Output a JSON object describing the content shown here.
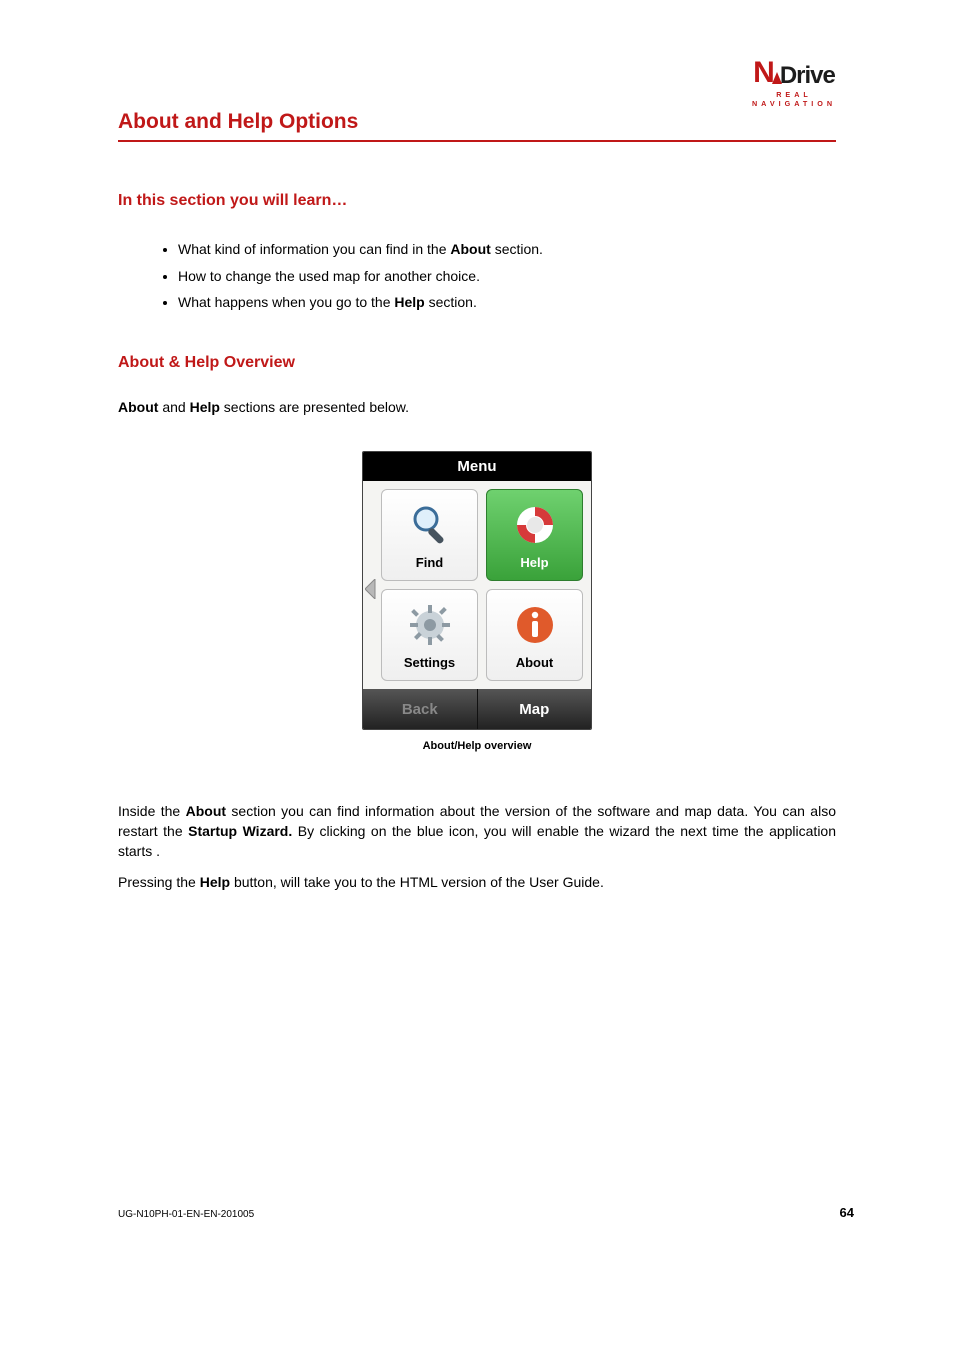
{
  "logo": {
    "first": "N",
    "rest": "Drive",
    "tagline": "REAL NAVIGATION"
  },
  "title": "About and Help Options",
  "learn_heading": "In this section you will learn…",
  "bullets": {
    "b1_pre": "What kind of information you can find in the ",
    "b1_bold": "About",
    "b1_post": " section.",
    "b2": "How to change the used map for another choice.",
    "b3_pre": "What happens when you go to the ",
    "b3_bold": "Help",
    "b3_post": " section."
  },
  "overview_heading": "About & Help Overview",
  "overview_line": {
    "b1": "About",
    "mid": " and ",
    "b2": "Help",
    "tail": " sections are presented below."
  },
  "device": {
    "menu": "Menu",
    "find": "Find",
    "help": "Help",
    "settings": "Settings",
    "about": "About",
    "back": "Back",
    "map": "Map"
  },
  "caption": "About/Help overview",
  "para1": {
    "t1": "Inside the ",
    "b1": "About",
    "t2": " section you can find information about the version of the software and map data. You can also restart the ",
    "b2": "Startup Wizard.",
    "t3": " By clicking on the blue icon, you will enable the wizard the next time the application starts ."
  },
  "para2": {
    "t1": "Pressing the ",
    "b1": "Help",
    "t2": " button, will take you to the HTML version of the User Guide."
  },
  "footer": {
    "code": "UG-N10PH-01-EN-EN-201005",
    "page": "64"
  }
}
